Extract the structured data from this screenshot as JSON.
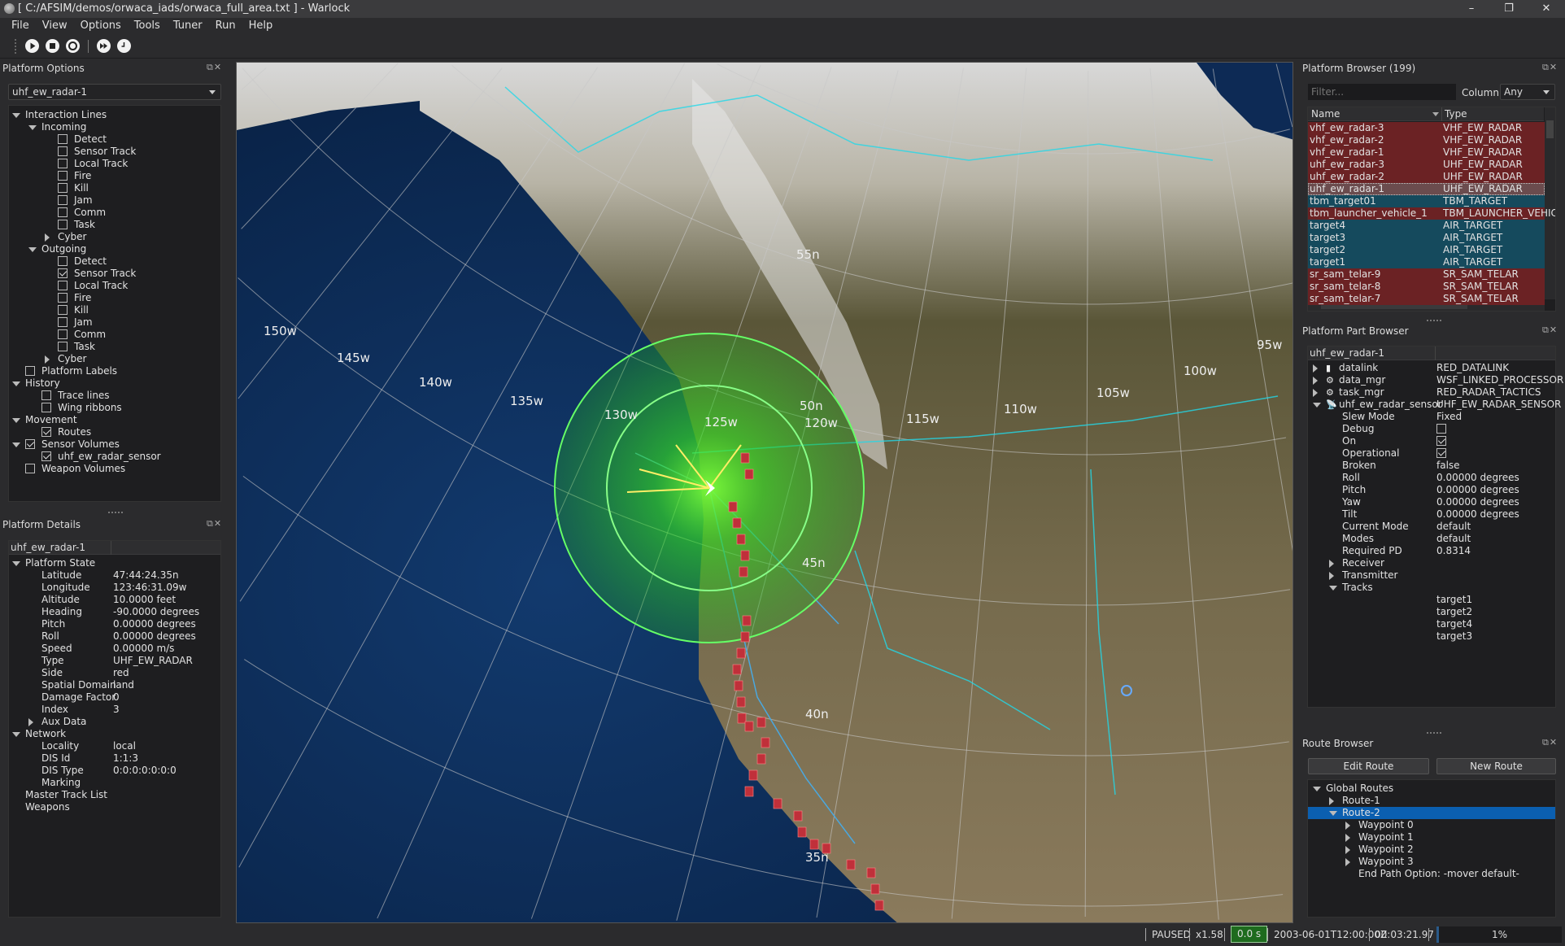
{
  "window": {
    "title": "[ C:/AFSIM/demos/orwaca_iads/orwaca_full_area.txt ] - Warlock",
    "minimize": "–",
    "restore": "❐",
    "close": "✕"
  },
  "menu": [
    "File",
    "View",
    "Options",
    "Tools",
    "Tuner",
    "Run",
    "Help"
  ],
  "toolbar": [
    {
      "icon": "play-icon"
    },
    {
      "icon": "stop-icon"
    },
    {
      "icon": "restart-icon"
    },
    {
      "icon": "fast-forward-icon"
    },
    {
      "icon": "clock-icon"
    }
  ],
  "platform_options": {
    "title": "Platform Options",
    "selected": "uhf_ew_radar-1",
    "tree": [
      {
        "label": "Interaction Lines",
        "level": 0,
        "expand": "open"
      },
      {
        "label": "Incoming",
        "level": 1,
        "expand": "open"
      },
      {
        "label": "Detect",
        "level": 2,
        "check": false
      },
      {
        "label": "Sensor Track",
        "level": 2,
        "check": false
      },
      {
        "label": "Local Track",
        "level": 2,
        "check": false
      },
      {
        "label": "Fire",
        "level": 2,
        "check": false
      },
      {
        "label": "Kill",
        "level": 2,
        "check": false
      },
      {
        "label": "Jam",
        "level": 2,
        "check": false
      },
      {
        "label": "Comm",
        "level": 2,
        "check": false
      },
      {
        "label": "Task",
        "level": 2,
        "check": false
      },
      {
        "label": "Cyber",
        "level": 2,
        "expand": "closed"
      },
      {
        "label": "Outgoing",
        "level": 1,
        "expand": "open"
      },
      {
        "label": "Detect",
        "level": 2,
        "check": false
      },
      {
        "label": "Sensor Track",
        "level": 2,
        "check": true
      },
      {
        "label": "Local Track",
        "level": 2,
        "check": false
      },
      {
        "label": "Fire",
        "level": 2,
        "check": false
      },
      {
        "label": "Kill",
        "level": 2,
        "check": false
      },
      {
        "label": "Jam",
        "level": 2,
        "check": false
      },
      {
        "label": "Comm",
        "level": 2,
        "check": false
      },
      {
        "label": "Task",
        "level": 2,
        "check": false
      },
      {
        "label": "Cyber",
        "level": 2,
        "expand": "closed"
      },
      {
        "label": "Platform Labels",
        "level": 0,
        "check": false
      },
      {
        "label": "History",
        "level": 0,
        "expand": "open"
      },
      {
        "label": "Trace lines",
        "level": 1,
        "check": false
      },
      {
        "label": "Wing ribbons",
        "level": 1,
        "check": false
      },
      {
        "label": "Movement",
        "level": 0,
        "expand": "open"
      },
      {
        "label": "Routes",
        "level": 1,
        "check": true
      },
      {
        "label": "Sensor Volumes",
        "level": 0,
        "expand": "open",
        "check": true
      },
      {
        "label": "uhf_ew_radar_sensor",
        "level": 1,
        "check": true
      },
      {
        "label": "Weapon Volumes",
        "level": 0,
        "check": false
      }
    ]
  },
  "platform_details": {
    "title": "Platform Details",
    "header": "uhf_ew_radar-1",
    "rows": [
      {
        "label": "Platform State",
        "level": 0,
        "expand": "open"
      },
      {
        "label": "Latitude",
        "value": "47:44:24.35n",
        "level": 1
      },
      {
        "label": "Longitude",
        "value": "123:46:31.09w",
        "level": 1
      },
      {
        "label": "Altitude",
        "value": "10.0000 feet",
        "level": 1
      },
      {
        "label": "Heading",
        "value": "-90.0000 degrees",
        "level": 1
      },
      {
        "label": "Pitch",
        "value": "0.00000 degrees",
        "level": 1
      },
      {
        "label": "Roll",
        "value": "0.00000 degrees",
        "level": 1
      },
      {
        "label": "Speed",
        "value": "0.00000 m/s",
        "level": 1
      },
      {
        "label": "Type",
        "value": "UHF_EW_RADAR",
        "level": 1
      },
      {
        "label": "Side",
        "value": "red",
        "level": 1
      },
      {
        "label": "Spatial Domain",
        "value": "land",
        "level": 1
      },
      {
        "label": "Damage Factor",
        "value": "0",
        "level": 1
      },
      {
        "label": "Index",
        "value": "3",
        "level": 1
      },
      {
        "label": "Aux Data",
        "level": 1,
        "expand": "closed"
      },
      {
        "label": "Network",
        "level": 0,
        "expand": "open"
      },
      {
        "label": "Locality",
        "value": "local",
        "level": 1
      },
      {
        "label": "DIS Id",
        "value": "1:1:3",
        "level": 1
      },
      {
        "label": "DIS Type",
        "value": "0:0:0:0:0:0:0",
        "level": 1
      },
      {
        "label": "Marking",
        "value": "",
        "level": 1
      },
      {
        "label": "Master Track List",
        "level": 0
      },
      {
        "label": "Weapons",
        "level": 0
      }
    ]
  },
  "platform_browser": {
    "title": "Platform Browser (199)",
    "filter_placeholder": "Filter...",
    "column_label": "Column:",
    "column_value": "Any",
    "col_name": "Name",
    "col_type": "Type",
    "rows": [
      {
        "name": "vhf_ew_radar-3",
        "type": "VHF_EW_RADAR",
        "side": "red"
      },
      {
        "name": "vhf_ew_radar-2",
        "type": "VHF_EW_RADAR",
        "side": "red"
      },
      {
        "name": "vhf_ew_radar-1",
        "type": "VHF_EW_RADAR",
        "side": "red"
      },
      {
        "name": "uhf_ew_radar-3",
        "type": "UHF_EW_RADAR",
        "side": "red"
      },
      {
        "name": "uhf_ew_radar-2",
        "type": "UHF_EW_RADAR",
        "side": "red"
      },
      {
        "name": "uhf_ew_radar-1",
        "type": "UHF_EW_RADAR",
        "side": "red",
        "selected": true
      },
      {
        "name": "tbm_target01",
        "type": "TBM_TARGET",
        "side": "blue"
      },
      {
        "name": "tbm_launcher_vehicle_1",
        "type": "TBM_LAUNCHER_VEHICLE",
        "side": "red"
      },
      {
        "name": "target4",
        "type": "AIR_TARGET",
        "side": "blue"
      },
      {
        "name": "target3",
        "type": "AIR_TARGET",
        "side": "blue"
      },
      {
        "name": "target2",
        "type": "AIR_TARGET",
        "side": "blue"
      },
      {
        "name": "target1",
        "type": "AIR_TARGET",
        "side": "blue"
      },
      {
        "name": "sr_sam_telar-9",
        "type": "SR_SAM_TELAR",
        "side": "red"
      },
      {
        "name": "sr_sam_telar-8",
        "type": "SR_SAM_TELAR",
        "side": "red"
      },
      {
        "name": "sr_sam_telar-7",
        "type": "SR_SAM_TELAR",
        "side": "red"
      }
    ],
    "colors": {
      "red": "#6b2224",
      "blue": "#154a5d",
      "selected": "#6b4c4e"
    }
  },
  "platform_part_browser": {
    "title": "Platform Part Browser",
    "header": "uhf_ew_radar-1",
    "rows": [
      {
        "label": "datalink",
        "value": "RED_DATALINK",
        "level": 0,
        "expand": "closed",
        "icon": "radio-icon"
      },
      {
        "label": "data_mgr",
        "value": "WSF_LINKED_PROCESSOR",
        "level": 0,
        "expand": "closed",
        "icon": "gears-icon"
      },
      {
        "label": "task_mgr",
        "value": "RED_RADAR_TACTICS",
        "level": 0,
        "expand": "closed",
        "icon": "gears-icon"
      },
      {
        "label": "uhf_ew_radar_sensor",
        "value": "UHF_EW_RADAR_SENSOR",
        "level": 0,
        "expand": "open",
        "icon": "radar-dish-icon"
      },
      {
        "label": "Slew Mode",
        "value": "Fixed",
        "level": 1
      },
      {
        "label": "Debug",
        "check": false,
        "level": 1
      },
      {
        "label": "On",
        "check": true,
        "level": 1
      },
      {
        "label": "Operational",
        "check": true,
        "level": 1
      },
      {
        "label": "Broken",
        "value": "false",
        "level": 1
      },
      {
        "label": "Roll",
        "value": "0.00000 degrees",
        "level": 1
      },
      {
        "label": "Pitch",
        "value": "0.00000 degrees",
        "level": 1
      },
      {
        "label": "Yaw",
        "value": "0.00000 degrees",
        "level": 1
      },
      {
        "label": "Tilt",
        "value": "0.00000 degrees",
        "level": 1
      },
      {
        "label": "Current Mode",
        "value": "default",
        "level": 1
      },
      {
        "label": "Modes",
        "value": "default",
        "level": 1
      },
      {
        "label": "Required PD",
        "value": "0.8314",
        "level": 1
      },
      {
        "label": "Receiver",
        "level": 1,
        "expand": "closed"
      },
      {
        "label": "Transmitter",
        "level": 1,
        "expand": "closed"
      },
      {
        "label": "Tracks",
        "level": 1,
        "expand": "open"
      },
      {
        "label": "",
        "value": "target1",
        "level": 1
      },
      {
        "label": "",
        "value": "target2",
        "level": 1
      },
      {
        "label": "",
        "value": "target4",
        "level": 1
      },
      {
        "label": "",
        "value": "target3",
        "level": 1
      }
    ]
  },
  "route_browser": {
    "title": "Route Browser",
    "edit_route": "Edit Route",
    "new_route": "New Route",
    "rows": [
      {
        "label": "Global Routes",
        "level": 0,
        "expand": "open"
      },
      {
        "label": "Route-1",
        "level": 1,
        "expand": "closed"
      },
      {
        "label": "Route-2",
        "level": 1,
        "expand": "open",
        "selected": true
      },
      {
        "label": "Waypoint 0",
        "level": 2,
        "expand": "closed"
      },
      {
        "label": "Waypoint 1",
        "level": 2,
        "expand": "closed"
      },
      {
        "label": "Waypoint 2",
        "level": 2,
        "expand": "closed"
      },
      {
        "label": "Waypoint 3",
        "level": 2,
        "expand": "closed"
      },
      {
        "label": "End Path Option:   -mover default-",
        "level": 2
      }
    ]
  },
  "map": {
    "lon_labels": [
      "150w",
      "145w",
      "140w",
      "135w",
      "130w",
      "125w",
      "120w",
      "115w",
      "110w",
      "105w",
      "100w",
      "95w"
    ],
    "lat_labels": [
      "55n",
      "50n",
      "45n",
      "40n",
      "35n"
    ],
    "colors": {
      "ocean": "#0c2a52",
      "land": "#6b6248",
      "sensor": "#33dd33"
    }
  },
  "status": {
    "state": "PAUSED",
    "rate": "x1.58",
    "sim_time": "0.0 s",
    "datetime": "2003-06-01T12:00:00Z",
    "wall_time": "00:03:21.97",
    "progress_label": "1%",
    "progress": 1
  }
}
